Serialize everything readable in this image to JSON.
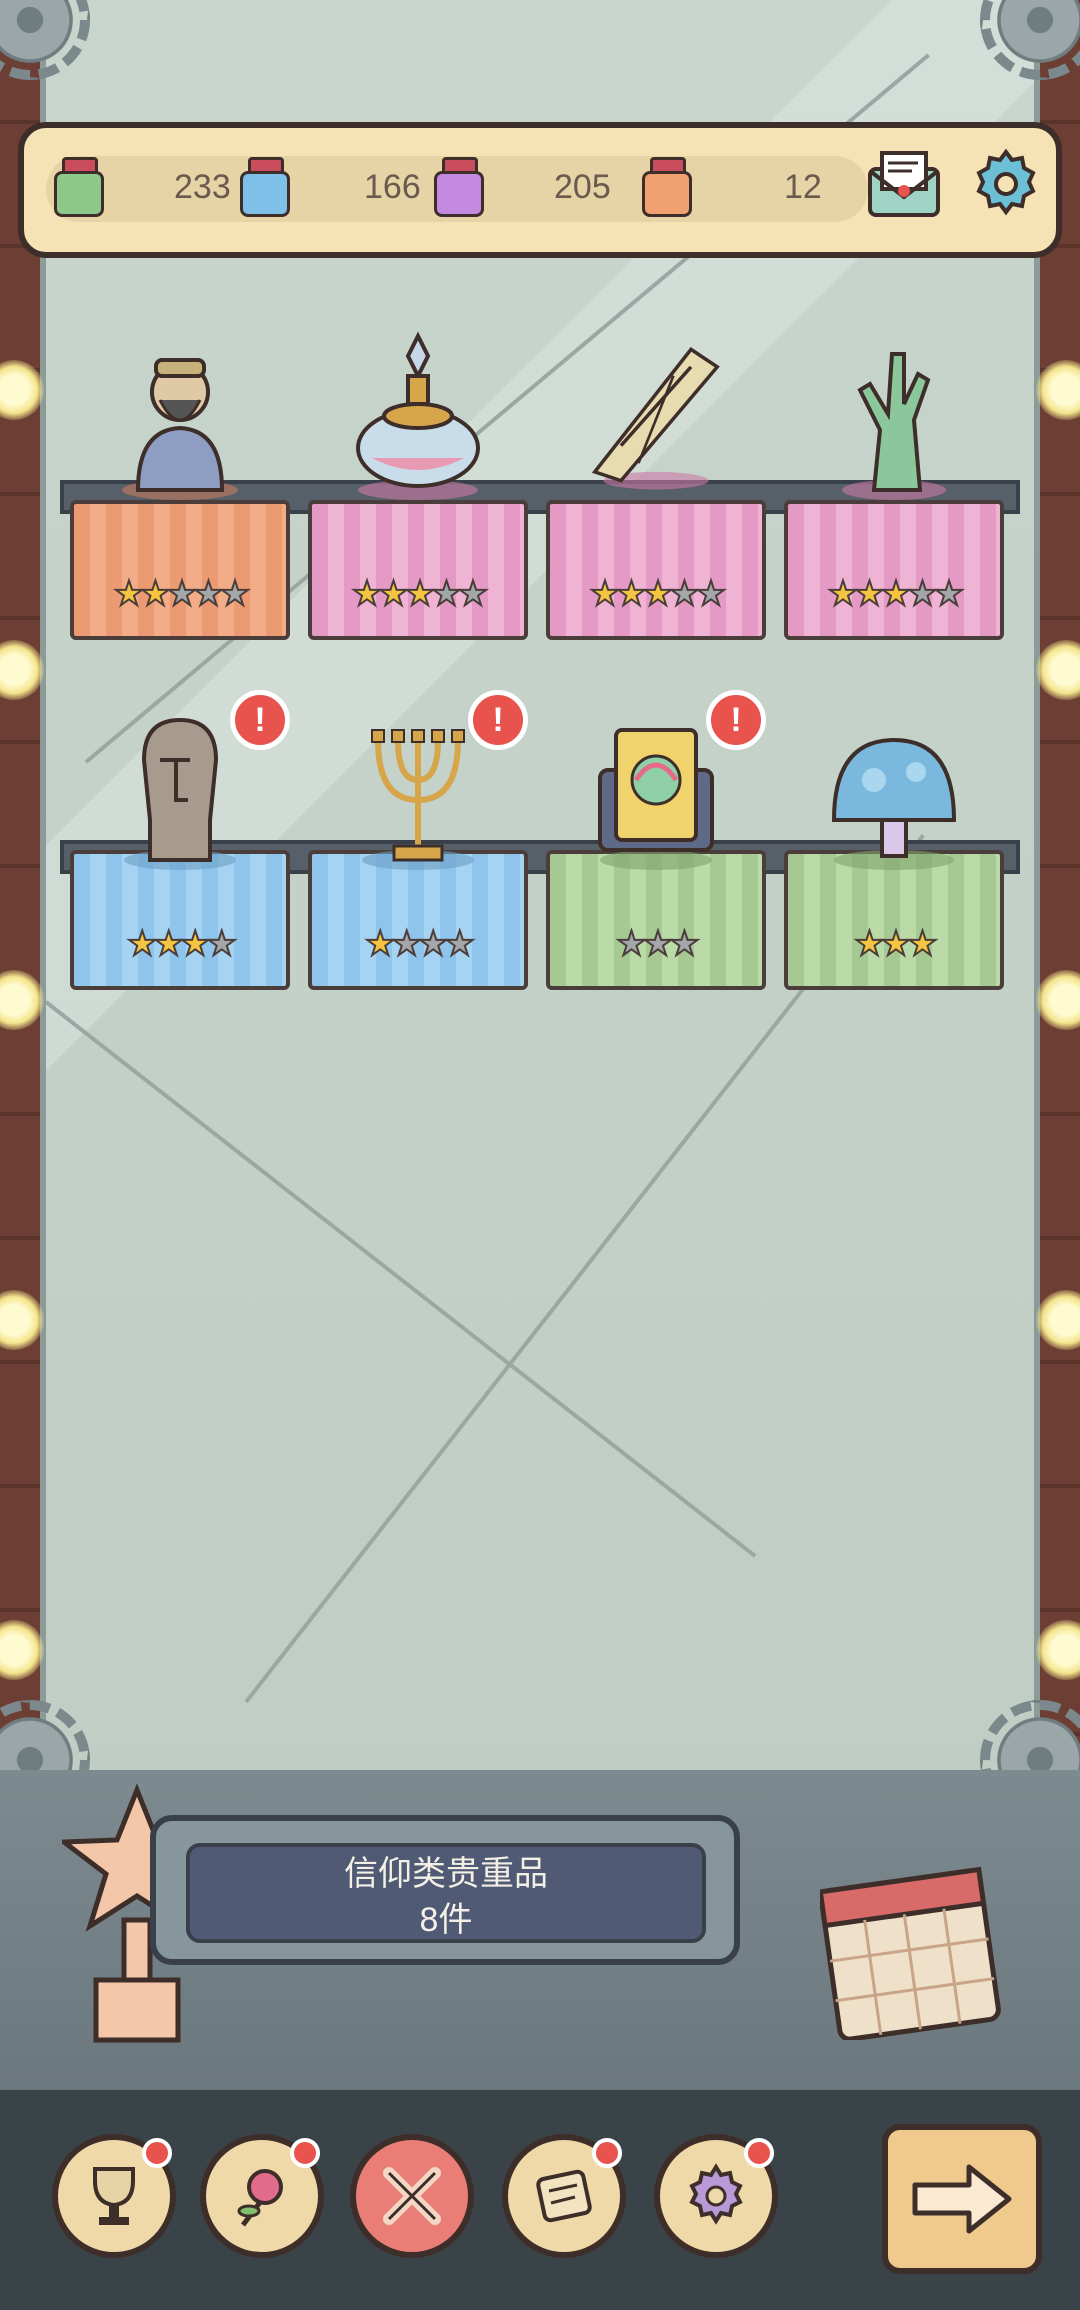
{
  "resources": [
    {
      "icon": "jar-green-icon",
      "color": "#8fc98a",
      "value": "233"
    },
    {
      "icon": "jar-blue-icon",
      "color": "#7ec0e8",
      "value": "166"
    },
    {
      "icon": "jar-purple-icon",
      "color": "#c48ae0",
      "value": "205"
    },
    {
      "icon": "jar-orange-icon",
      "color": "#f1a06f",
      "value": "12"
    }
  ],
  "header": {
    "mail_icon": "mail-icon",
    "settings_icon": "gear-icon"
  },
  "shelves": [
    {
      "items": [
        {
          "name": "bearded-statue",
          "cloth": "orange",
          "stars": 2,
          "max_stars": 5,
          "alert": false
        },
        {
          "name": "perfume-bottle",
          "cloth": "pink",
          "stars": 3,
          "max_stars": 5,
          "alert": false
        },
        {
          "name": "wrapped-staff",
          "cloth": "pink",
          "stars": 3,
          "max_stars": 5,
          "alert": false
        },
        {
          "name": "zombie-hand",
          "cloth": "pink",
          "stars": 3,
          "max_stars": 5,
          "alert": false
        }
      ]
    },
    {
      "items": [
        {
          "name": "moai-head",
          "cloth": "blue",
          "stars": 3,
          "max_stars": 4,
          "alert": true
        },
        {
          "name": "candelabra",
          "cloth": "blue",
          "stars": 1,
          "max_stars": 4,
          "alert": true
        },
        {
          "name": "rainbow-book",
          "cloth": "green",
          "stars": 0,
          "max_stars": 3,
          "alert": true
        },
        {
          "name": "blue-mushroom",
          "cloth": "green",
          "stars": 3,
          "max_stars": 3,
          "alert": false
        }
      ]
    }
  ],
  "plaque": {
    "line1": "信仰类贵重品",
    "line2": "8件"
  },
  "nav": [
    {
      "icon": "trophy-cup-icon",
      "active": false,
      "dot": true
    },
    {
      "icon": "rose-icon",
      "active": false,
      "dot": true
    },
    {
      "icon": "crossed-tools-icon",
      "active": true,
      "dot": false
    },
    {
      "icon": "scroll-icon",
      "active": false,
      "dot": true
    },
    {
      "icon": "cog-icon",
      "active": false,
      "dot": true
    }
  ],
  "next_button": {
    "icon": "arrow-right-icon"
  }
}
